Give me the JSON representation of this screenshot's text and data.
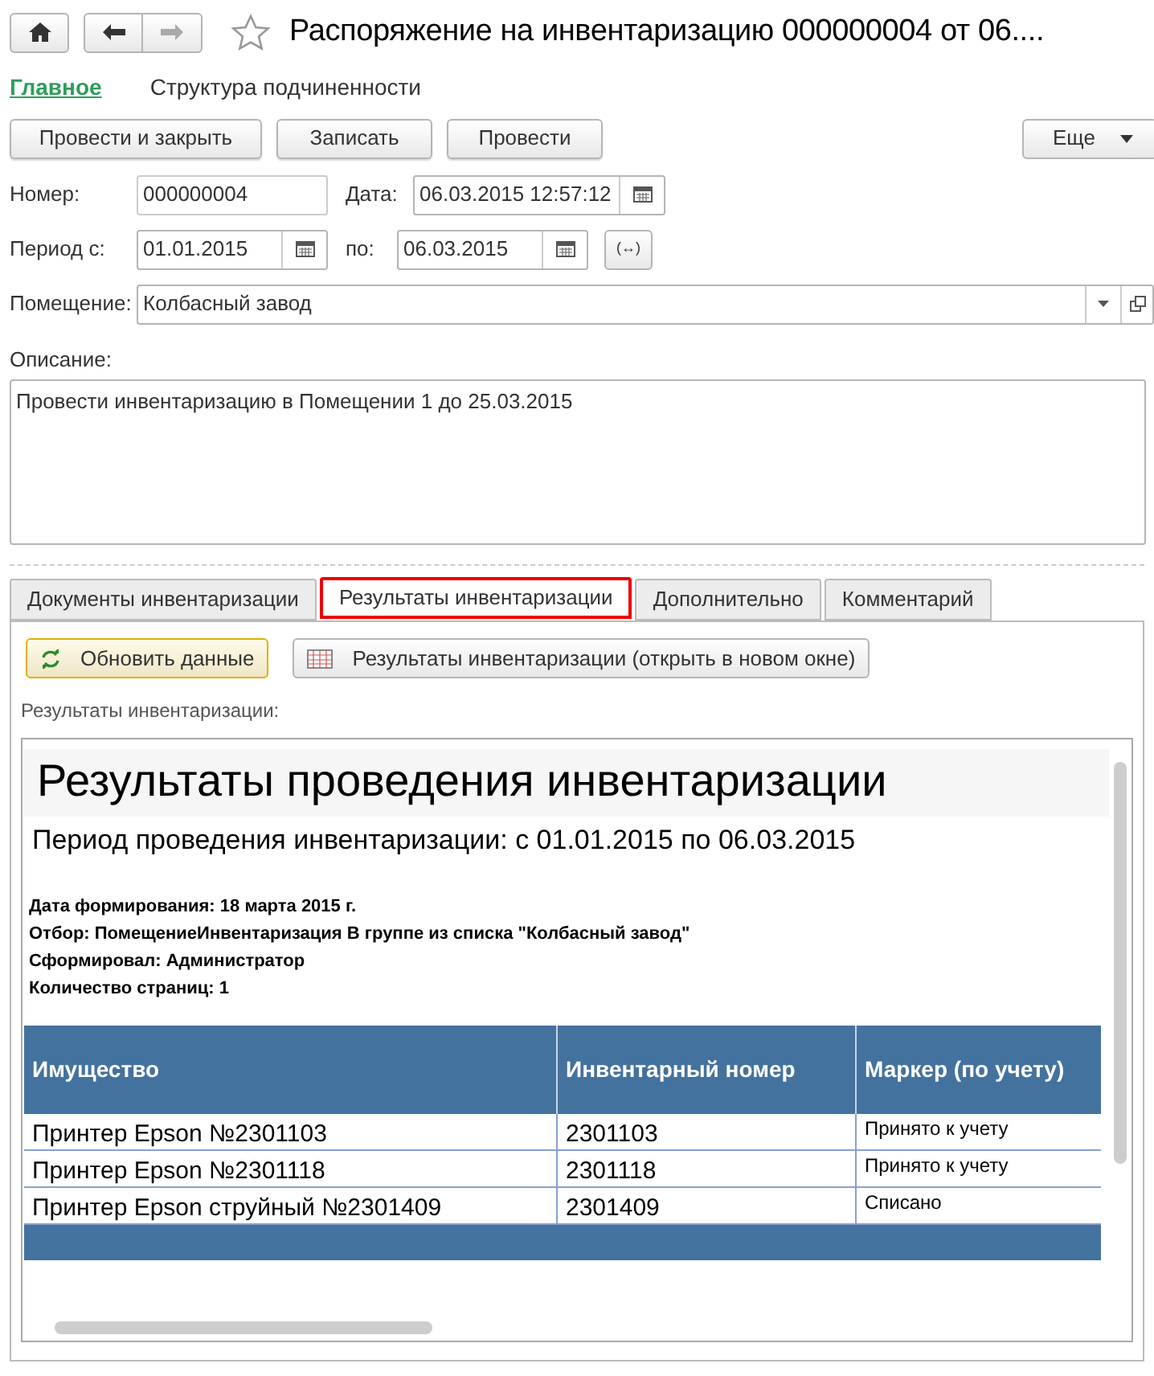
{
  "window": {
    "title": "Распоряжение на инвентаризацию 000000004 от 06...."
  },
  "sections": [
    {
      "label": "Главное",
      "selected": true
    },
    {
      "label": "Структура подчиненности",
      "selected": false
    }
  ],
  "commands": [
    "Провести и закрыть",
    "Записать",
    "Провести"
  ],
  "more": "Еще",
  "number": {
    "label": "Номер:",
    "value": "000000004"
  },
  "date": {
    "label": "Дата:",
    "value": "06.03.2015 12:57:12"
  },
  "period_from": {
    "label": "Период с:",
    "value": "01.01.2015"
  },
  "period_to": {
    "label": "по:",
    "value": "06.03.2015"
  },
  "period_button": "(↔)",
  "premises": {
    "label": "Помещение:",
    "value": "Колбасный завод"
  },
  "description": {
    "label": "Описание:",
    "value": "Провести инвентаризацию в Помещении 1 до 25.03.2015"
  },
  "tabs": [
    {
      "label": "Документы инвентаризации",
      "selected": false
    },
    {
      "label": "Результаты инвентаризации",
      "selected": true
    },
    {
      "label": "Дополнительно",
      "selected": false
    },
    {
      "label": "Комментарий",
      "selected": false
    }
  ],
  "tab_commands": [
    {
      "label": "Обновить данные",
      "kind": "refresh",
      "focused": true
    },
    {
      "label": "Результаты инвентаризации (открыть в новом окне)",
      "kind": "table",
      "focused": false
    }
  ],
  "report_label": "Результаты инвентаризации:",
  "report": {
    "title": "Результаты проведения инвентаризации",
    "subtitle": "Период проведения инвентаризации: с 01.01.2015 по 06.03.2015",
    "meta": [
      "Дата формирования: 18 марта 2015 г.",
      "Отбор: ПомещениеИнвентаризация В группе из списка \"Колбасный завод\"",
      "Сформировал: Администратор",
      "Количество страниц: 1"
    ],
    "columns": [
      "Имущество",
      "Инвентарный номер",
      "Маркер (по учету)"
    ],
    "rows": [
      [
        "Принтер Epson №2301103",
        "2301103",
        "Принято к учету"
      ],
      [
        "Принтер Epson №2301118",
        "2301118",
        "Принято к учету"
      ],
      [
        "Принтер Epson струйный №2301409",
        "2301409",
        "Списано"
      ]
    ]
  }
}
